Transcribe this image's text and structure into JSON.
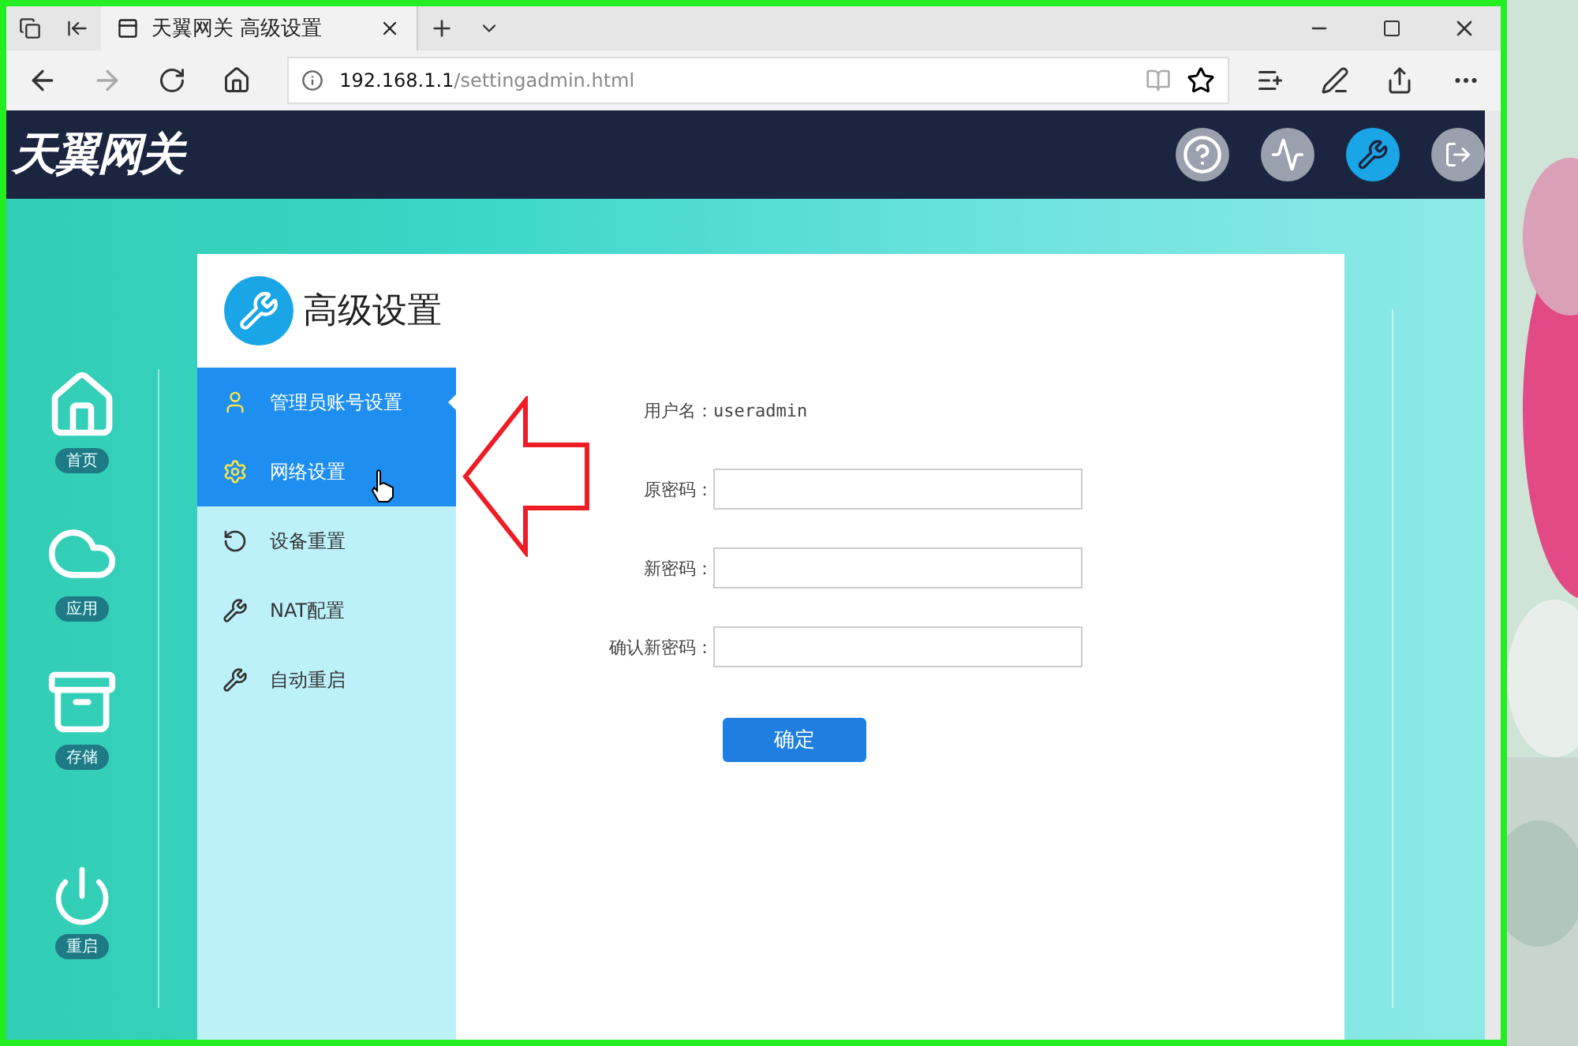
{
  "browser": {
    "tab_title": "天翼网关 高级设置",
    "address": {
      "host": "192.168.1.1",
      "path": "/settingadmin.html"
    }
  },
  "header": {
    "logo": "天翼网关",
    "actions": [
      {
        "kind": "help",
        "selected": false
      },
      {
        "kind": "chart",
        "selected": false
      },
      {
        "kind": "settings",
        "selected": true
      },
      {
        "kind": "logout",
        "selected": false
      }
    ]
  },
  "sidebar": {
    "top": [
      {
        "kind": "home",
        "label": "首页"
      },
      {
        "kind": "cloud",
        "label": "应用"
      },
      {
        "kind": "storage",
        "label": "存储"
      }
    ],
    "bottom": [
      {
        "kind": "power",
        "label": "重启"
      }
    ]
  },
  "panel": {
    "title": "高级设置",
    "menu": [
      {
        "kind": "user",
        "label": "管理员账号设置",
        "selected": true,
        "hovered": false
      },
      {
        "kind": "gear",
        "label": "网络设置",
        "selected": false,
        "hovered": true
      },
      {
        "kind": "reset",
        "label": "设备重置",
        "selected": false,
        "hovered": false
      },
      {
        "kind": "wrench",
        "label": "NAT配置",
        "selected": false,
        "hovered": false
      },
      {
        "kind": "wrench",
        "label": "自动重启",
        "selected": false,
        "hovered": false
      }
    ],
    "username": {
      "label": "用户名：",
      "value": "useradmin"
    },
    "fields": [
      {
        "label": "原密码："
      },
      {
        "label": "新密码："
      },
      {
        "label": "确认新密码："
      }
    ],
    "submit": "确定"
  }
}
